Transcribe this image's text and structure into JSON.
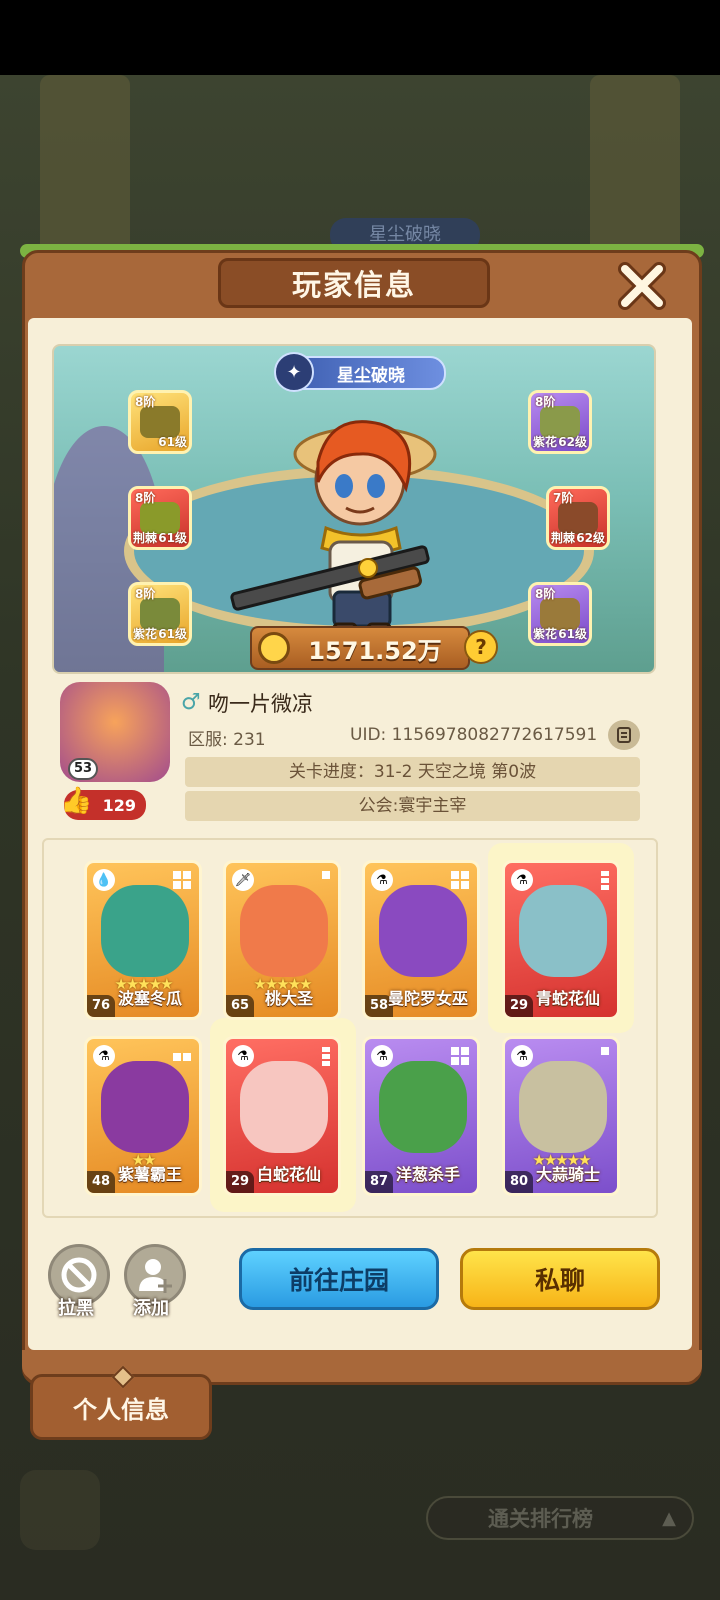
{
  "background": {
    "banner_peek": "星尘破晓"
  },
  "dialog": {
    "title": "玩家信息",
    "close_icon": "close-x-icon"
  },
  "hero": {
    "title_badge": "星尘破晓",
    "power": "1571.52万",
    "equipment": [
      {
        "rank": "8阶",
        "level": "61级",
        "trait": "",
        "color": "gold",
        "icon": "hat-icon"
      },
      {
        "rank": "8阶",
        "level": "61级",
        "trait": "荆棘",
        "color": "red",
        "icon": "gloves-icon"
      },
      {
        "rank": "8阶",
        "level": "61级",
        "trait": "紫花",
        "color": "gold",
        "icon": "pants-icon"
      },
      {
        "rank": "8阶",
        "level": "62级",
        "trait": "紫花",
        "color": "purple",
        "icon": "armor-icon"
      },
      {
        "rank": "7阶",
        "level": "62级",
        "trait": "荆棘",
        "color": "red",
        "icon": "belt-icon"
      },
      {
        "rank": "8阶",
        "level": "61级",
        "trait": "紫花",
        "color": "purple",
        "icon": "boots-icon"
      }
    ]
  },
  "player": {
    "avatar_level": "53",
    "likes": "129",
    "name": "吻一片微凉",
    "server": "区服: 231",
    "uid": "UID: 1156978082772617591",
    "progress": "关卡进度：31-2  天空之境 第0波",
    "guild": "公会:寰宇主宰"
  },
  "cards": [
    {
      "name": "波塞冬瓜",
      "level": "76",
      "stars": "★★★★★",
      "color": "orange",
      "type": "water-drop-icon",
      "glow": false
    },
    {
      "name": "桃大圣",
      "level": "65",
      "stars": "★★★★★",
      "color": "orange",
      "type": "sword-icon",
      "glow": false
    },
    {
      "name": "曼陀罗女巫",
      "level": "58",
      "stars": "",
      "color": "orange",
      "type": "potion-icon",
      "glow": false
    },
    {
      "name": "青蛇花仙",
      "level": "29",
      "stars": "",
      "color": "red",
      "type": "potion-icon",
      "glow": true
    },
    {
      "name": "紫薯霸王",
      "level": "48",
      "stars": "★★",
      "color": "orange",
      "type": "potion-icon",
      "glow": false
    },
    {
      "name": "白蛇花仙",
      "level": "29",
      "stars": "",
      "color": "red",
      "type": "potion-icon",
      "glow": true
    },
    {
      "name": "洋葱杀手",
      "level": "87",
      "stars": "",
      "color": "purple",
      "type": "potion-icon",
      "glow": false
    },
    {
      "name": "大蒜骑士",
      "level": "80",
      "stars": "★★★★★",
      "color": "purple",
      "type": "potion-icon",
      "glow": false
    }
  ],
  "actions": {
    "block_label": "拉黑",
    "add_label": "添加",
    "visit_label": "前往庄园",
    "chat_label": "私聊"
  },
  "tabs": {
    "personal": "个人信息"
  },
  "footer": {
    "ranking": "通关排行榜"
  }
}
